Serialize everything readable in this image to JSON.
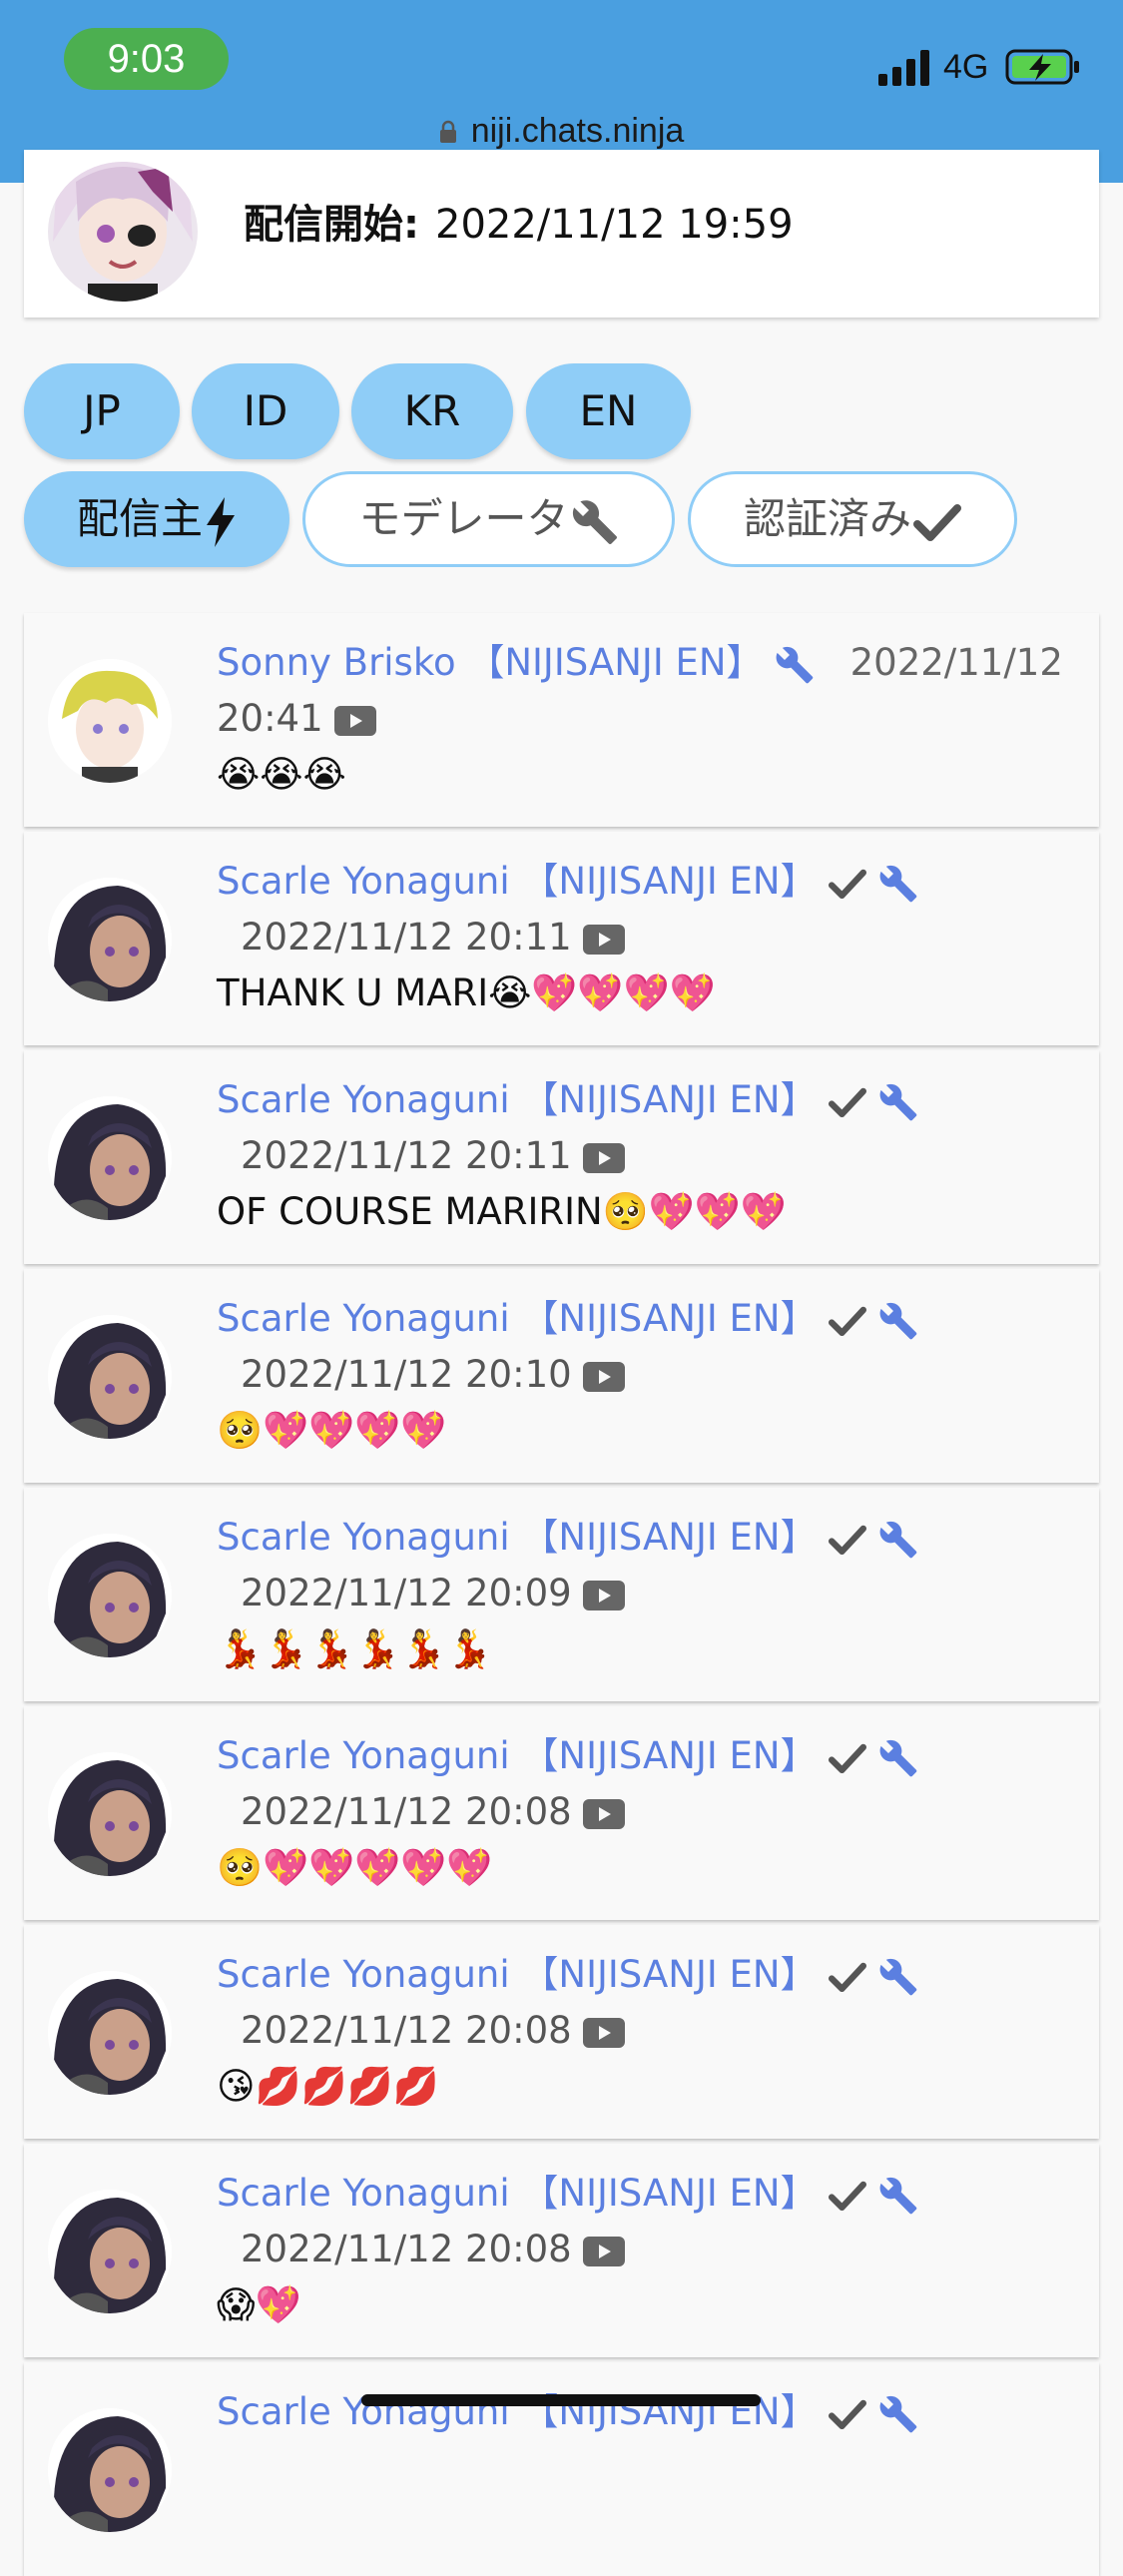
{
  "status": {
    "time": "9:03",
    "network": "4G"
  },
  "browser": {
    "url": "niji.chats.ninja"
  },
  "stream": {
    "start_label": "配信開始:",
    "start_time": "2022/11/12 19:59"
  },
  "filters": {
    "regions": [
      "JP",
      "ID",
      "KR",
      "EN"
    ],
    "roles": [
      "配信主",
      "モデレータ",
      "認証済み"
    ]
  },
  "messages": [
    {
      "name": "Sonny Brisko 【NIJISANJI EN】",
      "date": "2022/11/12",
      "time": "20:41",
      "text": "😭😭😭",
      "verified": false,
      "moderator": true
    },
    {
      "name": "Scarle Yonaguni 【NIJISANJI EN】",
      "datetime": "2022/11/12 20:11",
      "text": "THANK U MARI😭💖💖💖💖",
      "verified": true,
      "moderator": true
    },
    {
      "name": "Scarle Yonaguni 【NIJISANJI EN】",
      "datetime": "2022/11/12 20:11",
      "text": "OF COURSE MARIRIN🥺💖💖💖",
      "verified": true,
      "moderator": true
    },
    {
      "name": "Scarle Yonaguni 【NIJISANJI EN】",
      "datetime": "2022/11/12 20:10",
      "text": "🥺💖💖💖💖",
      "verified": true,
      "moderator": true
    },
    {
      "name": "Scarle Yonaguni 【NIJISANJI EN】",
      "datetime": "2022/11/12 20:09",
      "text": "💃💃💃💃💃💃",
      "verified": true,
      "moderator": true
    },
    {
      "name": "Scarle Yonaguni 【NIJISANJI EN】",
      "datetime": "2022/11/12 20:08",
      "text": "🥺💖💖💖💖💖",
      "verified": true,
      "moderator": true
    },
    {
      "name": "Scarle Yonaguni 【NIJISANJI EN】",
      "datetime": "2022/11/12 20:08",
      "text": "😘💋💋💋💋",
      "verified": true,
      "moderator": true
    },
    {
      "name": "Scarle Yonaguni 【NIJISANJI EN】",
      "datetime": "2022/11/12 20:08",
      "text": "😱💖",
      "verified": true,
      "moderator": true
    },
    {
      "name": "Scarle Yonaguni 【NIJISANJI EN】",
      "verified": true,
      "moderator": true
    }
  ],
  "colors": {
    "header": "#4a9fe0",
    "pill": "#8fcdf7",
    "name": "#5b7fe0",
    "time_pill": "#4caf50"
  },
  "icons": [
    "lock-icon",
    "signal-icon",
    "battery-charging-icon",
    "bolt-icon",
    "wrench-icon",
    "check-icon",
    "youtube-icon"
  ]
}
